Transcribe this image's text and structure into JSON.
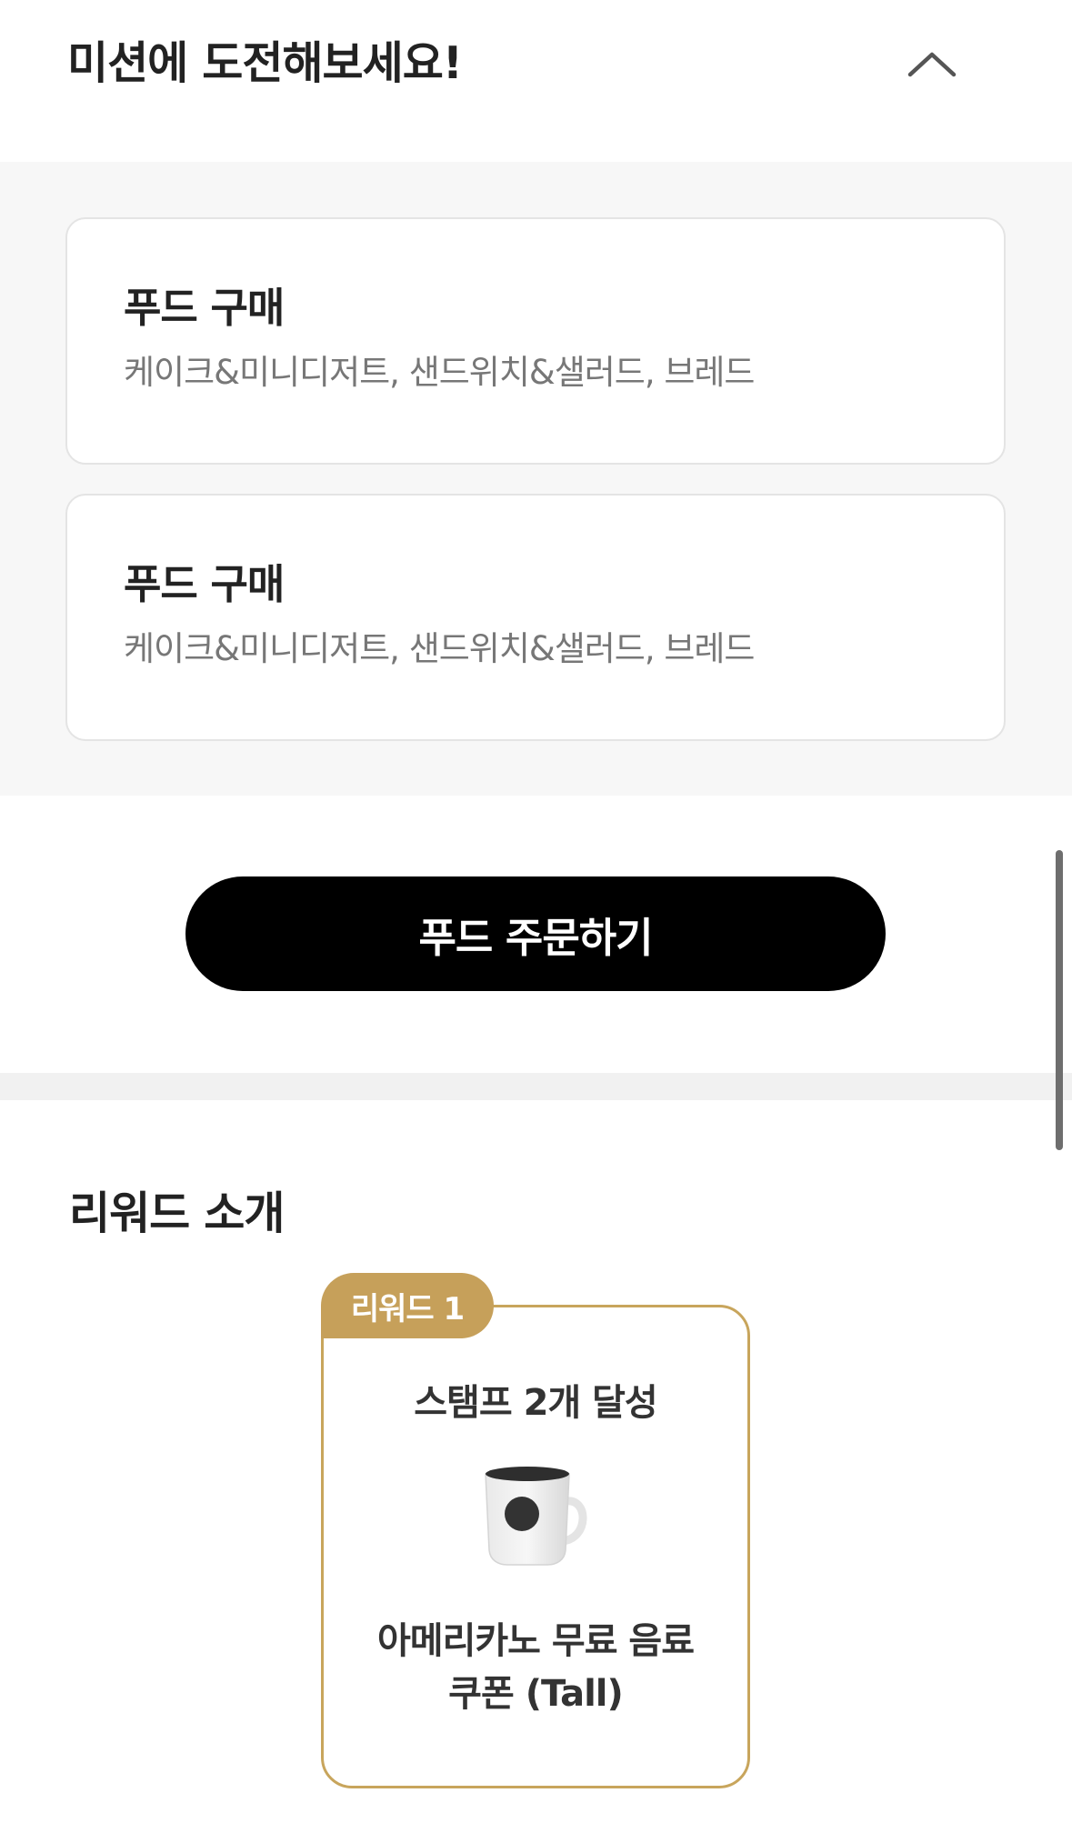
{
  "mission_section": {
    "title": "미션에 도전해보세요!",
    "collapse_icon": "chevron-up-icon"
  },
  "missions": [
    {
      "title": "푸드 구매",
      "description": "케이크&미니디저트, 샌드위치&샐러드, 브레드"
    },
    {
      "title": "푸드 구매",
      "description": "케이크&미니디저트, 샌드위치&샐러드, 브레드"
    }
  ],
  "order_button": {
    "label": "푸드 주문하기"
  },
  "reward_section": {
    "title": "리워드 소개",
    "rewards": [
      {
        "badge": "리워드 1",
        "condition": "스탬프 2개 달성",
        "image_icon": "coffee-mug-icon",
        "name_line1": "아메리카노 무료 음료",
        "name_line2": "쿠폰 (Tall)"
      }
    ]
  },
  "colors": {
    "accent_gold": "#c6a05a",
    "button_black": "#000000",
    "section_bg": "#f7f7f7"
  }
}
